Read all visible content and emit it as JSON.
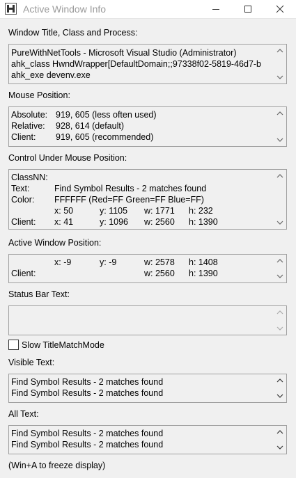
{
  "window": {
    "title": "Active Window Info",
    "icon": "autohotkey-h-icon"
  },
  "sections": {
    "window_title": {
      "label": "Window Title, Class and Process:",
      "lines": [
        "PureWithNetTools - Microsoft Visual Studio (Administrator)",
        "ahk_class HwndWrapper[DefaultDomain;;97338f02-5819-46d7-b",
        "ahk_exe devenv.exe"
      ]
    },
    "mouse_position": {
      "label": "Mouse Position:",
      "rows": [
        {
          "key": "Absolute:",
          "value": "919, 605 (less often used)"
        },
        {
          "key": "Relative:",
          "value": "928, 614 (default)"
        },
        {
          "key": "Client:",
          "value": "919, 605 (recommended)"
        }
      ]
    },
    "control": {
      "label": "Control Under Mouse Position:",
      "classnn": "ClassNN:",
      "text_key": "Text:",
      "text_value": "Find Symbol Results - 2 matches found",
      "color_key": "Color:",
      "color_value": "FFFFFF (Red=FF Green=FF Blue=FF)",
      "pos": {
        "x": "x: 50",
        "y": "y: 1105",
        "w": "w: 1771",
        "h": "h: 232"
      },
      "client_key": "Client:",
      "client": {
        "x": "x: 41",
        "y": "y: 1096",
        "w": "w: 2560",
        "h": "h: 1390"
      }
    },
    "active_window": {
      "label": "Active Window Position:",
      "pos": {
        "x": "x: -9",
        "y": "y: -9",
        "w": "w: 2578",
        "h": "h: 1408"
      },
      "client_key": "Client:",
      "client": {
        "w": "w: 2560",
        "h": "h: 1390"
      }
    },
    "status_bar": {
      "label": "Status Bar Text:"
    },
    "slow_mode": {
      "label": "Slow TitleMatchMode",
      "checked": false
    },
    "visible_text": {
      "label": "Visible Text:",
      "lines": [
        "Find Symbol Results - 2 matches found",
        "Find Symbol Results - 2 matches found"
      ]
    },
    "all_text": {
      "label": "All Text:",
      "lines": [
        "Find Symbol Results - 2 matches found",
        "Find Symbol Results - 2 matches found"
      ]
    }
  },
  "footer": "(Win+A to freeze display)"
}
